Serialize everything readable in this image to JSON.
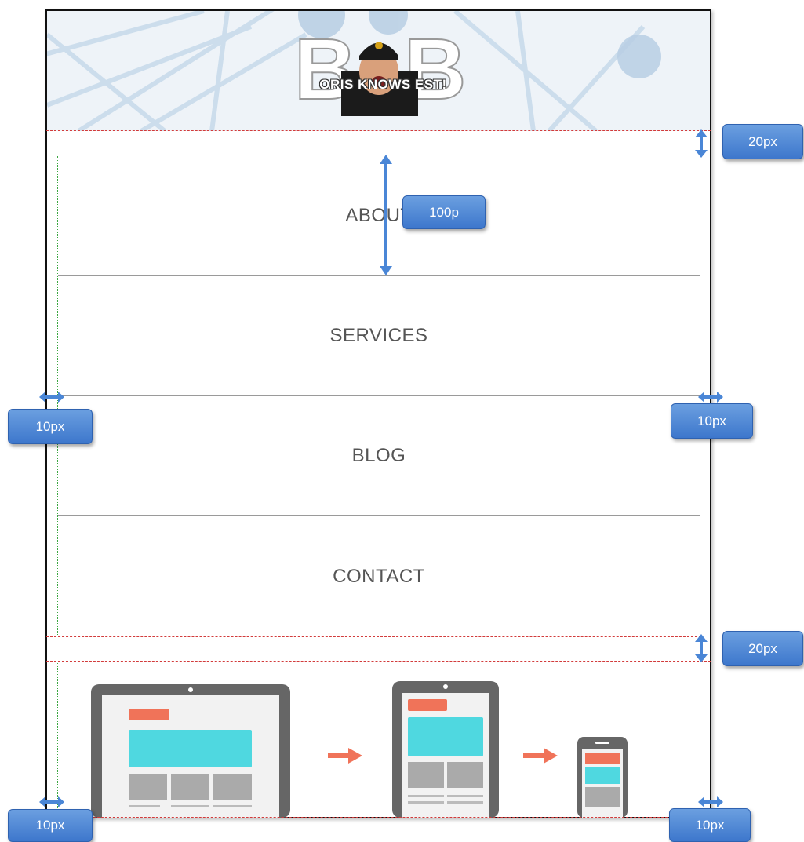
{
  "header": {
    "logo_text": "ORIS KNOWS EST!",
    "logo_letters": [
      "B",
      "B"
    ]
  },
  "nav": {
    "items": [
      {
        "label": "ABOUT"
      },
      {
        "label": "SERVICES"
      },
      {
        "label": "BLOG"
      },
      {
        "label": "CONTACT"
      }
    ]
  },
  "annotations": {
    "top_gap": "20px",
    "item_height": "100p",
    "left_padding": "10px",
    "right_padding": "10px",
    "middle_gap": "20px",
    "bottom_left_padding": "10px",
    "bottom_right_padding": "10px"
  },
  "colors": {
    "annotation": "#4a86d6",
    "nav_text": "#555555",
    "divider": "#9a9a9a",
    "section_border": "#d23b3b",
    "inner_border": "#3aa640",
    "device_body": "#666666",
    "accent_orange": "#f07359",
    "accent_cyan": "#4fd8e0"
  },
  "illustration": {
    "devices": [
      "desktop-icon",
      "tablet-icon",
      "phone-icon"
    ],
    "arrows": [
      "arrow-right-icon",
      "arrow-right-icon"
    ]
  }
}
